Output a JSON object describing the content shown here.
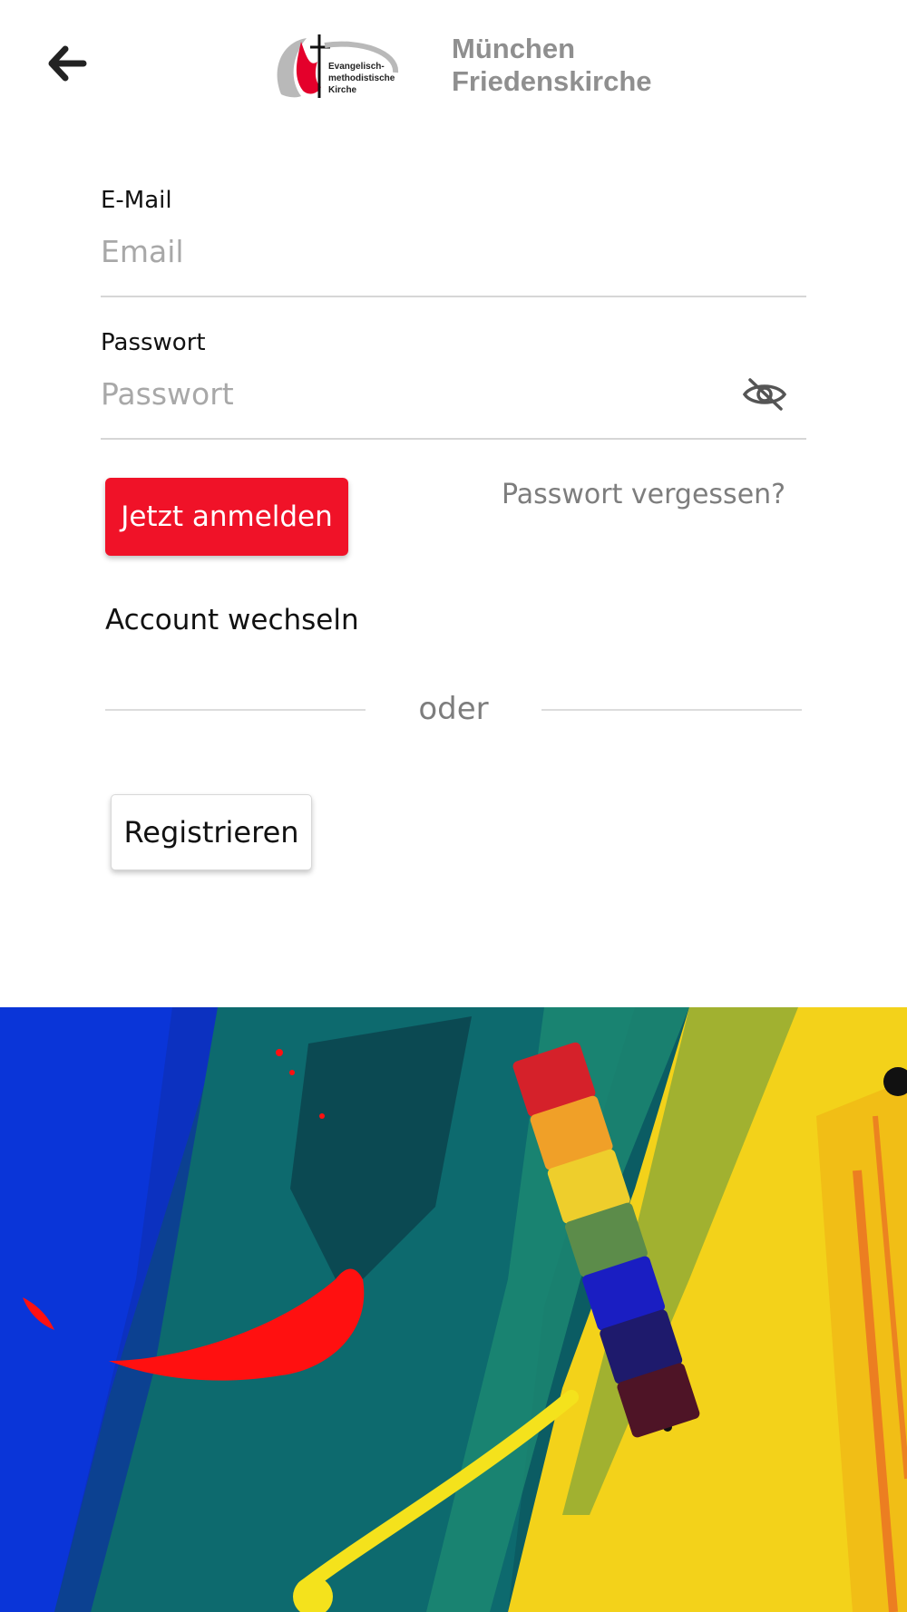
{
  "header": {
    "back_icon": "arrow-left-icon",
    "logo_lines": [
      "Evangelisch-",
      "methodistische",
      "Kirche"
    ],
    "church_name_line1": "München",
    "church_name_line2": "Friedenskirche"
  },
  "form": {
    "email": {
      "label": "E-Mail",
      "placeholder": "Email",
      "value": ""
    },
    "password": {
      "label": "Passwort",
      "placeholder": "Passwort",
      "value": "",
      "toggle_icon": "eye-off-icon"
    },
    "login_button": "Jetzt anmelden",
    "forgot_link": "Passwort vergessen?",
    "switch_account": "Account wechseln",
    "divider_text": "oder",
    "register_button": "Registrieren"
  },
  "colors": {
    "accent_red": "#f01228",
    "muted_gray": "#8f8f8f"
  }
}
